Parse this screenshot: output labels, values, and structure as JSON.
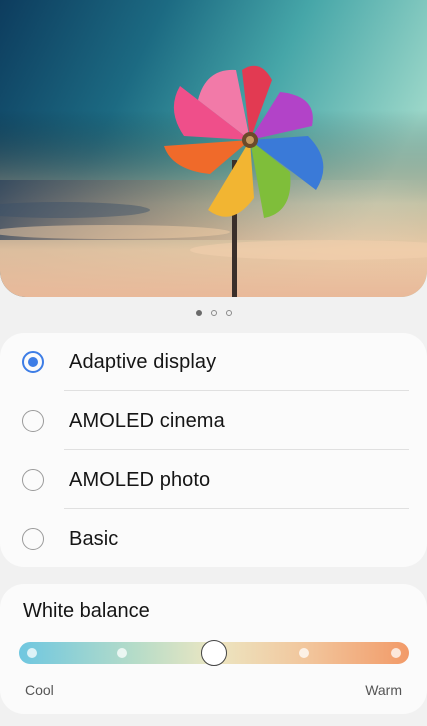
{
  "preview": {
    "image": "pinwheel-sky-photo",
    "pages": 3,
    "active_page": 1
  },
  "screen_modes": {
    "options": [
      {
        "label": "Adaptive display",
        "selected": true
      },
      {
        "label": "AMOLED cinema",
        "selected": false
      },
      {
        "label": "AMOLED photo",
        "selected": false
      },
      {
        "label": "Basic",
        "selected": false
      }
    ]
  },
  "white_balance": {
    "title": "White balance",
    "min_label": "Cool",
    "max_label": "Warm",
    "steps": 5,
    "value_step": 3,
    "colors": {
      "cool": "#6fc7e0",
      "warm": "#f29a68"
    }
  },
  "colors": {
    "accent": "#3d7de6",
    "background": "#f1f1f1",
    "card": "#fbfbfb"
  }
}
